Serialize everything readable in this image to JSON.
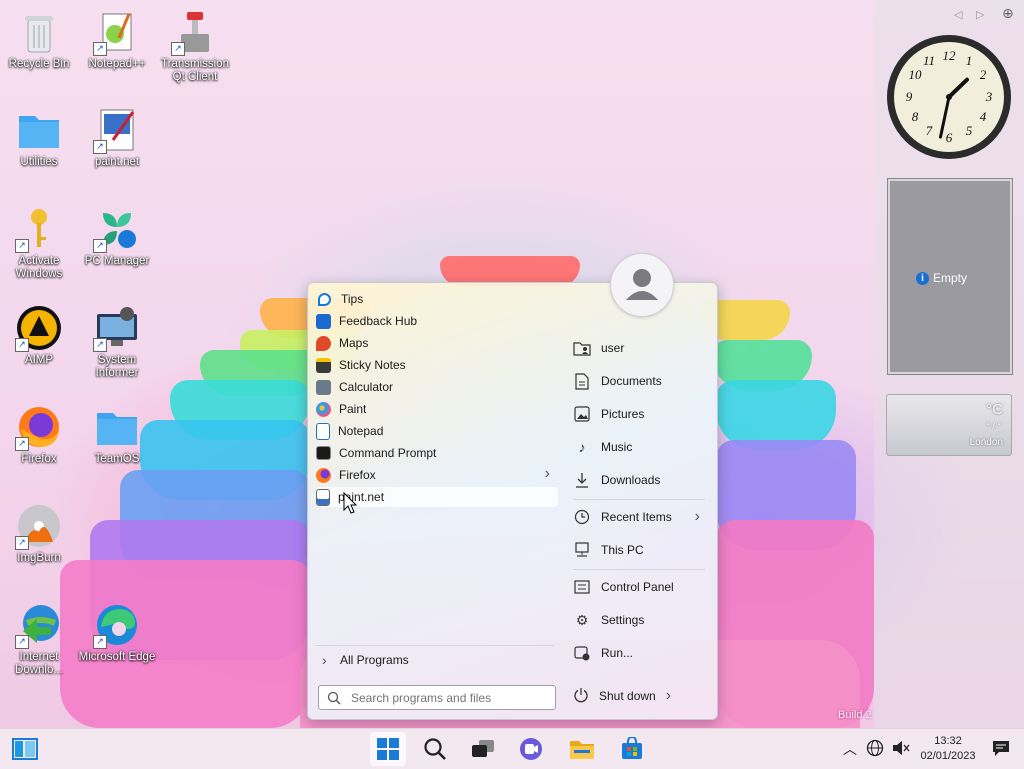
{
  "desktop": {
    "icons": [
      {
        "label": "Recycle Bin"
      },
      {
        "label": "Notepad++"
      },
      {
        "label": "Transmission Qt Client"
      },
      {
        "label": "Utilities"
      },
      {
        "label": "paint.net"
      },
      {
        "label": "Activate Windows"
      },
      {
        "label": "PC Manager"
      },
      {
        "label": "AIMP"
      },
      {
        "label": "System Informer"
      },
      {
        "label": "Firefox"
      },
      {
        "label": "TeamOS"
      },
      {
        "label": "ImgBurn"
      },
      {
        "label": "Internet Downlo..."
      },
      {
        "label": "Microsoft Edge"
      }
    ],
    "watermark": "Build 2"
  },
  "start_menu": {
    "programs": [
      {
        "label": "Tips"
      },
      {
        "label": "Feedback Hub"
      },
      {
        "label": "Maps"
      },
      {
        "label": "Sticky Notes"
      },
      {
        "label": "Calculator"
      },
      {
        "label": "Paint"
      },
      {
        "label": "Notepad"
      },
      {
        "label": "Command Prompt"
      },
      {
        "label": "Firefox",
        "arrow": "›"
      },
      {
        "label": "paint.net"
      }
    ],
    "all_programs": "All Programs",
    "search_placeholder": "Search programs and files",
    "places": [
      {
        "label": "user",
        "icon": "user-folder-icon"
      },
      {
        "label": "Documents",
        "icon": "document-icon"
      },
      {
        "label": "Pictures",
        "icon": "picture-icon"
      },
      {
        "label": "Music",
        "icon": "music-icon"
      },
      {
        "label": "Downloads",
        "icon": "download-icon"
      },
      {
        "label": "Recent Items",
        "icon": "clock-icon"
      },
      {
        "label": "This PC",
        "icon": "computer-icon"
      },
      {
        "label": "Control Panel",
        "icon": "control-panel-icon"
      },
      {
        "label": "Settings",
        "icon": "gear-icon"
      },
      {
        "label": "Run...",
        "icon": "run-icon"
      }
    ],
    "recent_arrow": "›",
    "shutdown": "Shut down",
    "shutdown_arrow": "›"
  },
  "gadgets": {
    "slideshow_text": "Empty",
    "weather_unit": "°C",
    "weather_sep": "° / °",
    "weather_city": "London",
    "clock": {
      "hour": 1,
      "minute": 32
    }
  },
  "taskbar": {
    "time": "13:32",
    "date": "02/01/2023"
  },
  "colors": {
    "accent": "#0067c0"
  }
}
